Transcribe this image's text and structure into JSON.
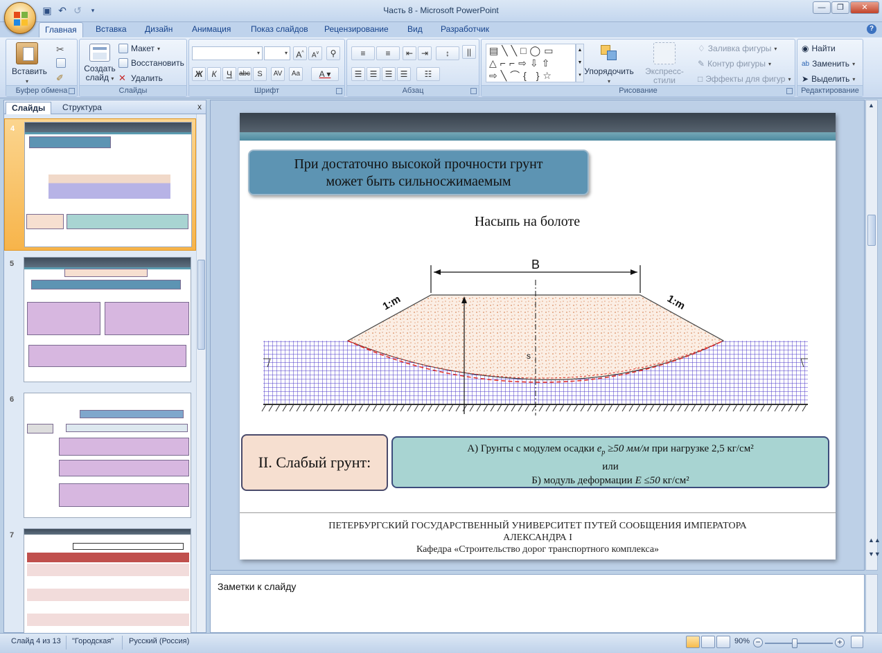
{
  "window": {
    "title": "Часть 8  -  Microsoft PowerPoint"
  },
  "ribbon": {
    "tabs": [
      "Главная",
      "Вставка",
      "Дизайн",
      "Анимация",
      "Показ слайдов",
      "Рецензирование",
      "Вид",
      "Разработчик"
    ],
    "clipboard": {
      "label": "Буфер обмена",
      "paste": "Вставить"
    },
    "slides": {
      "label": "Слайды",
      "create_line1": "Создать",
      "create_line2": "слайд",
      "layout": "Макет",
      "reset": "Восстановить",
      "delete": "Удалить"
    },
    "font": {
      "label": "Шрифт",
      "bold": "Ж",
      "italic": "К",
      "underline": "Ч",
      "strike": "abc"
    },
    "paragraph": {
      "label": "Абзац"
    },
    "drawing": {
      "label": "Рисование",
      "arrange": "Упорядочить",
      "quick_styles": "Экспресс-стили",
      "fill": "Заливка фигуры",
      "outline": "Контур фигуры",
      "effects": "Эффекты для фигур"
    },
    "editing": {
      "label": "Редактирование",
      "find": "Найти",
      "replace": "Заменить",
      "select": "Выделить"
    }
  },
  "panel": {
    "tab_slides": "Слайды",
    "tab_outline": "Структура",
    "close": "x",
    "numbers": [
      "4",
      "5",
      "6",
      "7"
    ]
  },
  "slide": {
    "title_line1": "При достаточно высокой прочности грунт",
    "title_line2": "может быть сильносжимаемым",
    "subtitle": "Насыпь на болоте",
    "diagram": {
      "width_label": "B",
      "slope_left": "1:m",
      "slope_right": "1:m",
      "depth_label": "s"
    },
    "weak_soil": "II. Слабый грунт:",
    "criteria": {
      "a_prefix": "А) Грунты с модулем осадки ",
      "a_var": "e",
      "a_sub": "p",
      "a_cond": " ≥50 мм/м ",
      "a_suffix": " при нагрузке 2,5 кг/см²",
      "or": "или",
      "b_prefix": "Б) модуль деформации ",
      "b_var": "E",
      "b_cond": " ≤50",
      "b_suffix": " кг/см²"
    },
    "footer_line1": "ПЕТЕРБУРГСКИЙ ГОСУДАРСТВЕННЫЙ УНИВЕРСИТЕТ ПУТЕЙ СООБЩЕНИЯ ИМПЕРАТОРА",
    "footer_line2": "АЛЕКСАНДРА I",
    "footer_line3": "Кафедра «Строительство дорог транспортного комплекса»"
  },
  "notes": {
    "placeholder": "Заметки к слайду"
  },
  "status": {
    "slide": "Слайд 4 из 13",
    "theme": "\"Городская\"",
    "language": "Русский (Россия)",
    "zoom": "90%",
    "zoom_value": 90
  }
}
